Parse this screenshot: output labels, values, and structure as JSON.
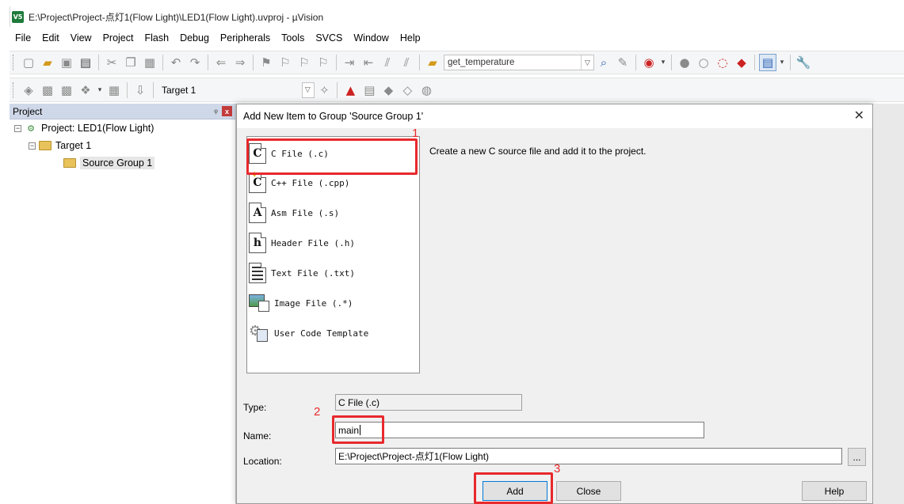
{
  "window": {
    "icon_label": "V5",
    "title": "E:\\Project\\Project-点灯1(Flow Light)\\LED1(Flow Light).uvproj - µVision"
  },
  "menu": [
    "File",
    "Edit",
    "View",
    "Project",
    "Flash",
    "Debug",
    "Peripherals",
    "Tools",
    "SVCS",
    "Window",
    "Help"
  ],
  "toolbar": {
    "find_combo_value": "get_temperature",
    "target_label": "Target 1"
  },
  "project_pane": {
    "title": "Project",
    "pin_glyph": "ᵩ",
    "close_glyph": "x",
    "tree": [
      {
        "label": "Project: LED1(Flow Light)",
        "expander": "−"
      },
      {
        "label": "Target 1",
        "expander": "−"
      },
      {
        "label": "Source Group 1"
      }
    ]
  },
  "dialog": {
    "title": "Add New Item to Group 'Source Group 1'",
    "close_glyph": "✕",
    "items": [
      {
        "label": "C File (.c)",
        "icon_letter": "C"
      },
      {
        "label": "C++ File (.cpp)",
        "icon_letter": "C"
      },
      {
        "label": "Asm File (.s)",
        "icon_letter": "A"
      },
      {
        "label": "Header File (.h)",
        "icon_letter": "h"
      },
      {
        "label": "Text File (.txt)"
      },
      {
        "label": "Image File (.*)"
      },
      {
        "label": "User Code Template"
      }
    ],
    "description": "Create a new C source file and add it to the project.",
    "type_label": "Type:",
    "type_value": "C File (.c)",
    "name_label": "Name:",
    "name_value": "main",
    "location_label": "Location:",
    "location_value": "E:\\Project\\Project-点灯1(Flow Light)",
    "browse_label": "...",
    "add_label": "Add",
    "close_label": "Close",
    "help_label": "Help"
  },
  "annotations": {
    "step1": "1",
    "step2": "2",
    "step3": "3",
    "color": "#e8292d"
  }
}
